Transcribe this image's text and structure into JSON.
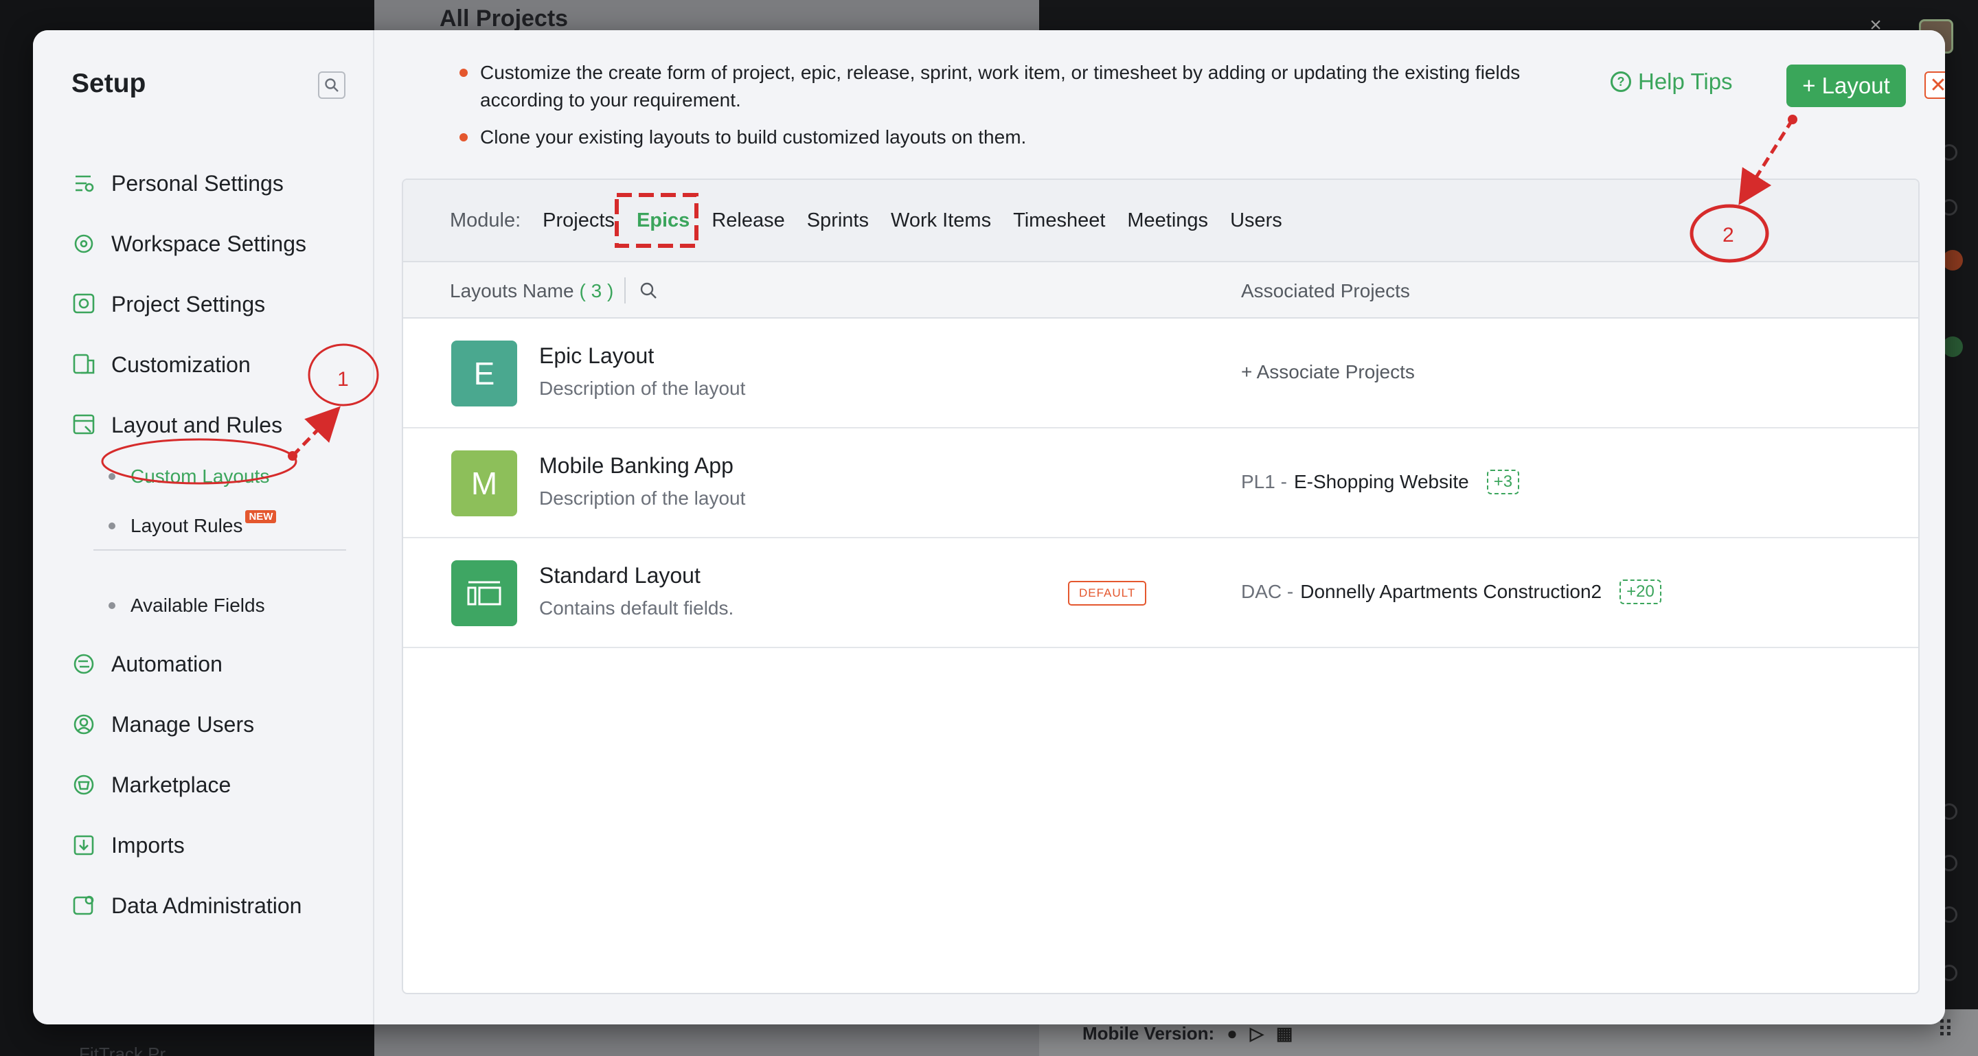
{
  "background": {
    "title": "All Projects",
    "mobile_version_label": "Mobile Version:",
    "left_footer": "FitTrack Pr..."
  },
  "setup": {
    "title": "Setup",
    "nav": [
      {
        "label": "Personal Settings",
        "icon": "personal-settings-icon"
      },
      {
        "label": "Workspace Settings",
        "icon": "workspace-settings-icon"
      },
      {
        "label": "Project Settings",
        "icon": "project-settings-icon"
      },
      {
        "label": "Customization",
        "icon": "customization-icon"
      },
      {
        "label": "Layout and Rules",
        "icon": "layout-rules-icon"
      }
    ],
    "sub_items": [
      {
        "label": "Custom Layouts",
        "active": true
      },
      {
        "label": "Layout Rules",
        "badge": "NEW"
      },
      {
        "label": "Available Fields"
      }
    ],
    "nav_bottom": [
      {
        "label": "Automation",
        "icon": "automation-icon"
      },
      {
        "label": "Manage Users",
        "icon": "manage-users-icon"
      },
      {
        "label": "Marketplace",
        "icon": "marketplace-icon"
      },
      {
        "label": "Imports",
        "icon": "imports-icon"
      },
      {
        "label": "Data Administration",
        "icon": "data-administration-icon"
      }
    ]
  },
  "tips": [
    "Customize the create form of project, epic, release, sprint, work item, or timesheet by adding or updating the existing fields according to your requirement.",
    "Clone your existing layouts to build customized layouts on them."
  ],
  "header": {
    "help_label": "Help Tips",
    "add_layout_label": "+ Layout"
  },
  "module": {
    "label": "Module:",
    "tabs": [
      "Projects",
      "Epics",
      "Release",
      "Sprints",
      "Work Items",
      "Timesheet",
      "Meetings",
      "Users"
    ],
    "active": "Epics"
  },
  "table": {
    "col_name": "Layouts Name",
    "count": "( 3 )",
    "col_projects": "Associated Projects",
    "rows": [
      {
        "initial": "E",
        "color": "#4aa88f",
        "name": "Epic Layout",
        "desc": "Description of the layout",
        "assoc_link": "+ Associate Projects"
      },
      {
        "initial": "M",
        "color": "#8dbf5a",
        "name": "Mobile Banking App",
        "desc": "Description of the layout",
        "code": "PL1 -",
        "project": "E-Shopping Website",
        "more": "+3"
      },
      {
        "initial": "",
        "color": "#3ea663",
        "name": "Standard Layout",
        "desc": "Contains default fields.",
        "badge": "DEFAULT",
        "code": "DAC -",
        "project": "Donnelly Apartments Construction2",
        "more": "+20"
      }
    ]
  },
  "annotations": {
    "step1": "1",
    "step2": "2"
  },
  "colors": {
    "accent_green": "#3ba55c",
    "annotation_red": "#d62b2b",
    "badge_orange": "#e4572e"
  }
}
